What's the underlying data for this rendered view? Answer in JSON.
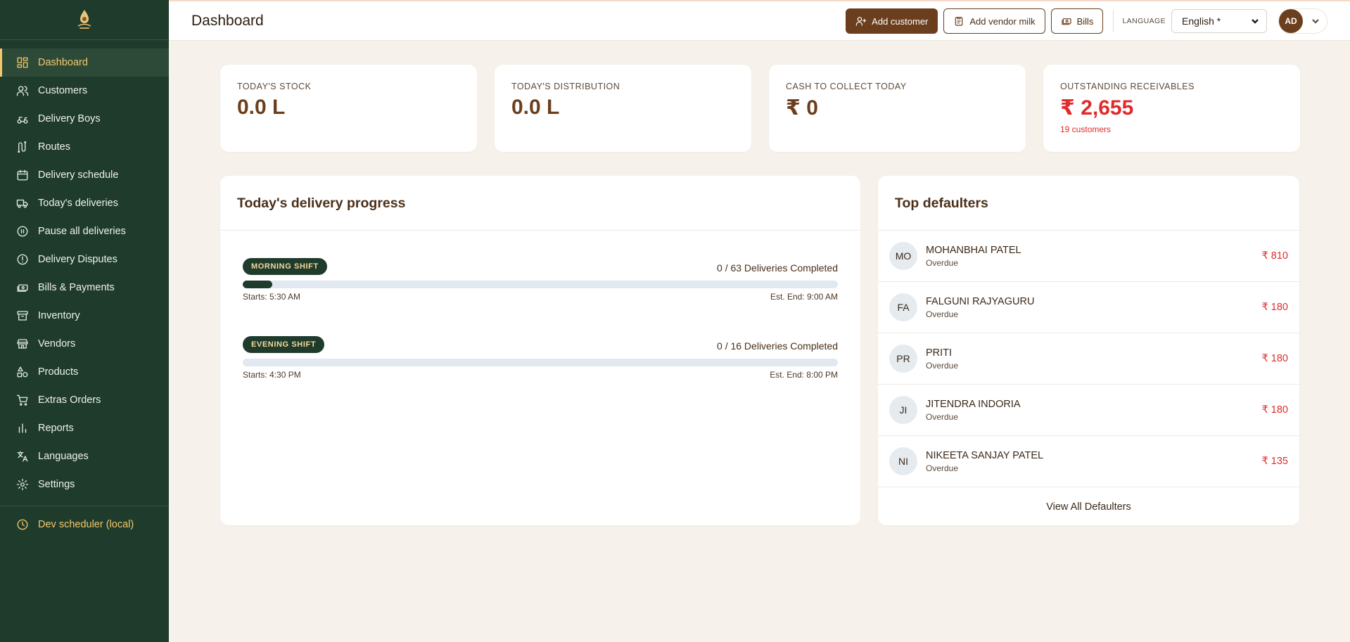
{
  "header": {
    "title": "Dashboard",
    "add_customer": "Add customer",
    "add_vendor_milk": "Add vendor milk",
    "bills": "Bills",
    "language_label": "LANGUAGE",
    "language_value": "English *",
    "avatar_initials": "AD"
  },
  "sidebar": {
    "items": [
      {
        "label": "Dashboard",
        "icon": "dashboard-icon"
      },
      {
        "label": "Customers",
        "icon": "users-icon"
      },
      {
        "label": "Delivery Boys",
        "icon": "scooter-icon"
      },
      {
        "label": "Routes",
        "icon": "route-icon"
      },
      {
        "label": "Delivery schedule",
        "icon": "calendar-icon"
      },
      {
        "label": "Today's deliveries",
        "icon": "truck-icon"
      },
      {
        "label": "Pause all deliveries",
        "icon": "pause-icon"
      },
      {
        "label": "Delivery Disputes",
        "icon": "alert-icon"
      },
      {
        "label": "Bills & Payments",
        "icon": "money-icon"
      },
      {
        "label": "Inventory",
        "icon": "archive-icon"
      },
      {
        "label": "Vendors",
        "icon": "store-icon"
      },
      {
        "label": "Products",
        "icon": "shapes-icon"
      },
      {
        "label": "Extras Orders",
        "icon": "cart-icon"
      },
      {
        "label": "Reports",
        "icon": "bar-chart-icon"
      },
      {
        "label": "Languages",
        "icon": "translate-icon"
      },
      {
        "label": "Settings",
        "icon": "gear-icon"
      }
    ],
    "dev_scheduler": "Dev scheduler (local)"
  },
  "stats": [
    {
      "label": "TODAY'S STOCK",
      "value": "0.0 L"
    },
    {
      "label": "TODAY'S DISTRIBUTION",
      "value": "0.0 L"
    },
    {
      "label": "CASH TO COLLECT TODAY",
      "value": "₹ 0"
    },
    {
      "label": "OUTSTANDING RECEIVABLES",
      "value": "₹ 2,655",
      "sub": "19 customers"
    }
  ],
  "progress": {
    "title": "Today's delivery progress",
    "shifts": [
      {
        "badge": "MORNING SHIFT",
        "count": "0 / 63 Deliveries Completed",
        "start": "Starts: 5:30 AM",
        "end": "Est. End: 9:00 AM",
        "fill_percent": 5
      },
      {
        "badge": "EVENING SHIFT",
        "count": "0 / 16 Deliveries Completed",
        "start": "Starts: 4:30 PM",
        "end": "Est. End: 8:00 PM",
        "fill_percent": 0
      }
    ]
  },
  "defaulters": {
    "title": "Top defaulters",
    "rows": [
      {
        "initials": "MO",
        "name": "MOHANBHAI PATEL",
        "status": "Overdue",
        "amount": "₹ 810"
      },
      {
        "initials": "FA",
        "name": "FALGUNI RAJYAGURU",
        "status": "Overdue",
        "amount": "₹ 180"
      },
      {
        "initials": "PR",
        "name": "PRITI",
        "status": "Overdue",
        "amount": "₹ 180"
      },
      {
        "initials": "JI",
        "name": "JITENDRA INDORIA",
        "status": "Overdue",
        "amount": "₹ 180"
      },
      {
        "initials": "NI",
        "name": "NIKEETA SANJAY PATEL",
        "status": "Overdue",
        "amount": "₹ 135"
      }
    ],
    "view_all": "View All Defaulters"
  },
  "colors": {
    "sidebar_bg": "#1f3b2c",
    "accent_gold": "#f4c86a",
    "brand_brown": "#6b3f1d",
    "danger_red": "#e02b2b"
  }
}
